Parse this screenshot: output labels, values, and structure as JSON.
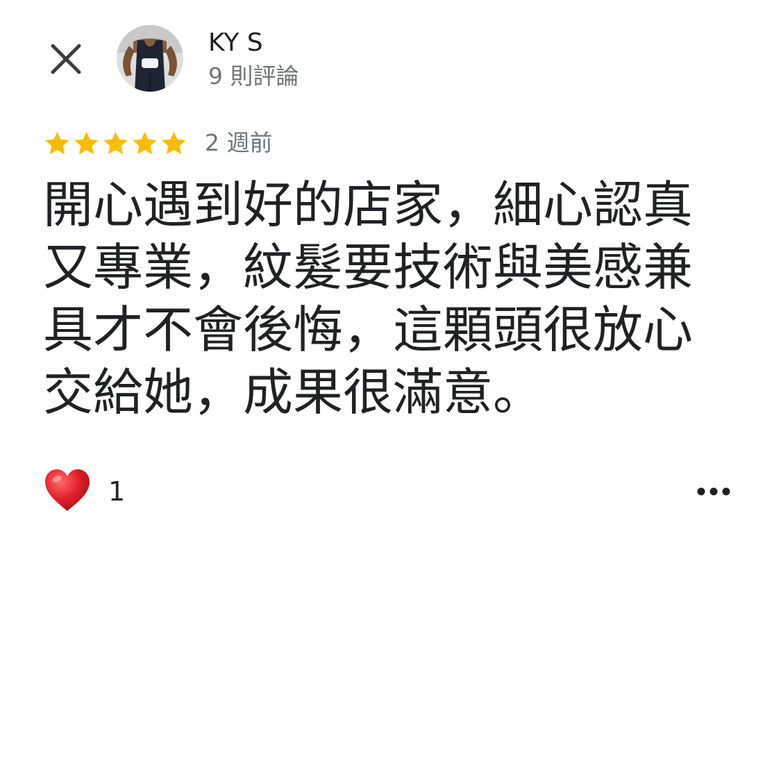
{
  "reviewer": {
    "name": "KY S",
    "review_count_label": "9 則評論",
    "avatar_icon": "user-avatar-photo"
  },
  "review": {
    "rating": 5,
    "max_rating": 5,
    "star_color": "#fbbc04",
    "time_label": "2 週前",
    "text": "開心遇到好的店家，細心認真又專業，紋髮要技術與美感兼具才不會後悔，這顆頭很放心交給她，成果很滿意。"
  },
  "actions": {
    "close_icon": "close-icon",
    "like_icon": "heart-icon",
    "like_color": "#e0202a",
    "like_count": "1",
    "more_icon": "more-horizontal-icon"
  }
}
